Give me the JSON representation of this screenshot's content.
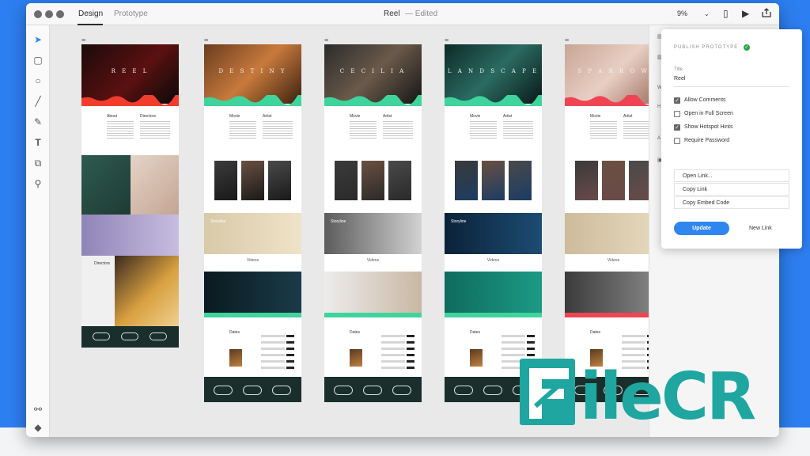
{
  "window": {
    "tabs": [
      "Design",
      "Prototype"
    ],
    "title": "Reel",
    "status": "— Edited",
    "zoom": "9%"
  },
  "toolbar": {
    "tools": [
      "select-tool",
      "rectangle-tool",
      "ellipse-tool",
      "line-tool",
      "pen-tool",
      "text-tool",
      "artboard-tool",
      "zoom-tool"
    ],
    "bottom": [
      "symbols-icon",
      "layers-icon"
    ]
  },
  "artboards": [
    {
      "hero_title": "R E E L",
      "accent": "#f23d2d",
      "portrait_tint": "#2d5b4f",
      "banner_title": "",
      "has_dates": false
    },
    {
      "hero_title": "D E S T I N Y",
      "accent": "#3fd49d",
      "portrait_tint": "#1a1a1a",
      "banner_title": "Storyline",
      "has_dates": true
    },
    {
      "hero_title": "C E C I L I A",
      "accent": "#3fd49d",
      "portrait_tint": "#2a2a2a",
      "banner_title": "Storyline",
      "has_dates": true
    },
    {
      "hero_title": "L A N D S C A P E",
      "accent": "#3fd49d",
      "portrait_tint": "#1c3c63",
      "banner_title": "Storyline",
      "has_dates": true
    },
    {
      "hero_title": "S P A R R O W",
      "accent": "#ef4453",
      "portrait_tint": "#6a4a4a",
      "banner_title": "",
      "has_dates": true
    }
  ],
  "section_labels": {
    "about": "About",
    "directors": "Directors",
    "videos": "Videos",
    "dates": "Dates"
  },
  "share_panel": {
    "heading": "PUBLISH PROTOTYPE",
    "title_label": "Title",
    "title_value": "Reel",
    "options": [
      {
        "label": "Allow Comments",
        "checked": true
      },
      {
        "label": "Open in Full Screen",
        "checked": false
      },
      {
        "label": "Show Hotspot Hints",
        "checked": true
      },
      {
        "label": "Require Password",
        "checked": false
      }
    ],
    "links": [
      "Open Link...",
      "Copy Link",
      "Copy Embed Code"
    ],
    "update_label": "Update",
    "new_link_label": "New Link",
    "accent": "#2f86ef"
  },
  "watermark": "FileCR"
}
